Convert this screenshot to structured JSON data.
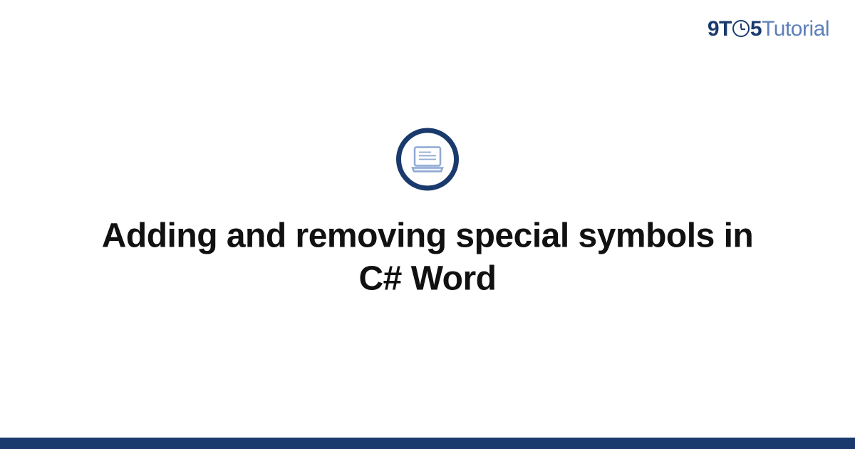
{
  "logo": {
    "part1": "9T",
    "part2": "5",
    "part3": "Tutorial"
  },
  "article": {
    "title": "Adding and removing special symbols in C# Word"
  },
  "colors": {
    "brand_dark": "#1a3a6e",
    "brand_light": "#5d7fb9"
  }
}
